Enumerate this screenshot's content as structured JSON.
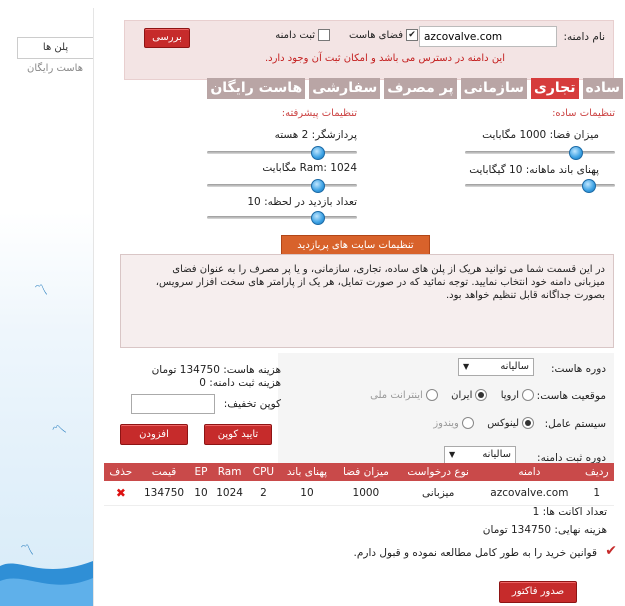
{
  "left_tabs": [
    {
      "label": "پلن ها"
    },
    {
      "label": "هاست رایگان"
    }
  ],
  "domain": {
    "label": "نام دامنه:",
    "value": "azcovalve.com",
    "hosting_space_label": "فضای هاست",
    "register_domain_label": "ثبت دامنه",
    "check_button": "بررسی",
    "message": "این دامنه در دسترس می باشد و امکان ثبت آن وجود دارد."
  },
  "plans": [
    "ساده",
    "تجاری",
    "سازمانی",
    "پر مصرف",
    "سفارشی",
    "هاست رایگان"
  ],
  "simple_settings": {
    "title": "تنظیمات ساده:",
    "disk": "میزان فضا: 1000 مگابایت",
    "bandwidth": "پهنای باند ماهانه: 10 گیگابایت"
  },
  "advanced_settings": {
    "title": "تنظیمات پیشرفته:",
    "cpu": "پردازشگر: 2 هسته",
    "ram": "Ram: 1024 مگابایت",
    "visits": "تعداد بازدید در لحظه: 10"
  },
  "sliders": {
    "disk_level": 0.75,
    "bandwidth_level": 0.85,
    "cpu_level": 0.75,
    "ram_level": 0.75,
    "visits_level": 0.75
  },
  "advanced_button": "تنظیمات سایت های پربازدید",
  "info_text": "در این قسمت شما می توانید هریک از پلن های ساده، تجاری، سازمانی، و یا پر مصرف را به عنوان فضای میزبانی دامنه خود انتخاب نمایید. توجه نمائید که در صورت تمایل، هر یک از پارامتر های سخت افزار سرویس، بصورت جداگانه قابل تنظیم خواهد بود.",
  "options": {
    "hosting_period_label": "دوره هاست:",
    "hosting_period_value": "سالیانه",
    "location_label": "موقعیت هاست:",
    "location_options": [
      "اروپا",
      "ایران",
      "اینترانت ملی"
    ],
    "os_label": "سیستم عامل:",
    "os_options": [
      "لینوکس",
      "ویندوز"
    ],
    "domain_period_label": "دوره ثبت دامنه:",
    "domain_period_value": "سالیانه"
  },
  "costs": {
    "hosting_cost": "هزینه هاست: 134750 تومان",
    "domain_cost": "هزینه ثبت دامنه: 0",
    "coupon_label": "کوپن تخفیف:",
    "confirm_coupon_button": "تایید کوپن",
    "add_button": "افزودن"
  },
  "table": {
    "headers": [
      "ردیف",
      "دامنه",
      "نوع درخواست",
      "میزان فضا",
      "پهنای باند",
      "CPU",
      "Ram",
      "EP",
      "قیمت",
      "حذف"
    ],
    "rows": [
      [
        "1",
        "azcovalve.com",
        "میزبانی",
        "1000",
        "10",
        "2",
        "1024",
        "10",
        "134750",
        ""
      ]
    ]
  },
  "summary": {
    "accounts_count": "تعداد اکانت ها: 1",
    "final_cost": "هزینه نهایی: 134750 تومان",
    "terms": "قوانین خرید را به طور کامل مطالعه نموده و قبول دارم.",
    "invoice_button": "صدور فاکتور"
  },
  "colors": {
    "accent_red": "#c62b2b",
    "plan_inactive": "#b9a5a5",
    "orange_button": "#d8622b",
    "domain_box_bg": "#f3e4e4"
  }
}
